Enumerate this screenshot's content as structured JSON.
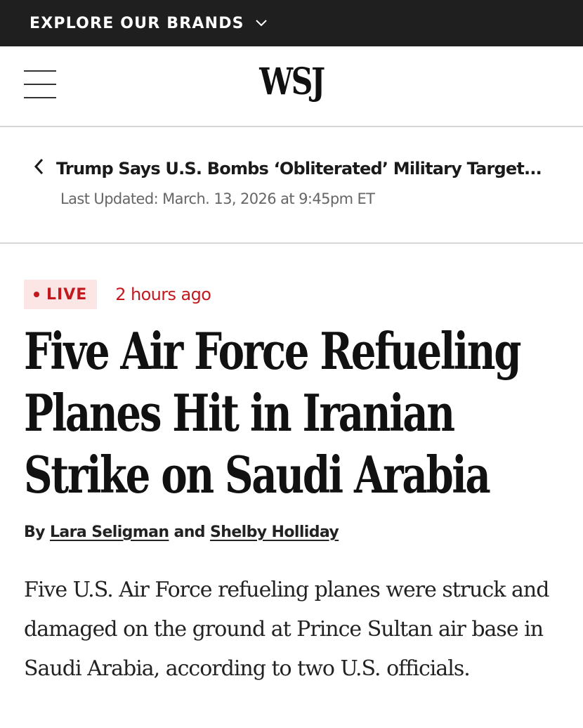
{
  "brands_bar": {
    "label": "EXPLORE OUR BRANDS",
    "chevron_icon": "chevron-down-icon"
  },
  "masthead": {
    "menu_icon": "hamburger-menu-icon",
    "logo": "WSJ"
  },
  "back_nav": {
    "icon": "chevron-left-icon",
    "title": "Trump Says U.S. Bombs ‘Obliterated’ Military Target...",
    "updated": "Last Updated: March. 13, 2026 at 9:45pm ET"
  },
  "status": {
    "live_label": "LIVE",
    "time_ago": "2 hours ago",
    "live_color": "#c2191f"
  },
  "article": {
    "headline_lines": [
      "Five Air Force Refueling",
      "Planes Hit in Iranian",
      "Strike on Saudi Arabia"
    ],
    "byline": {
      "prefix": "By",
      "author1": "Lara Seligman",
      "joiner": "and",
      "author2": "Shelby Holliday"
    },
    "lede": "Five U.S. Air Force refueling planes were struck and damaged on the ground at Prince Sultan air base in Saudi Arabia, according to two U.S. officials."
  }
}
